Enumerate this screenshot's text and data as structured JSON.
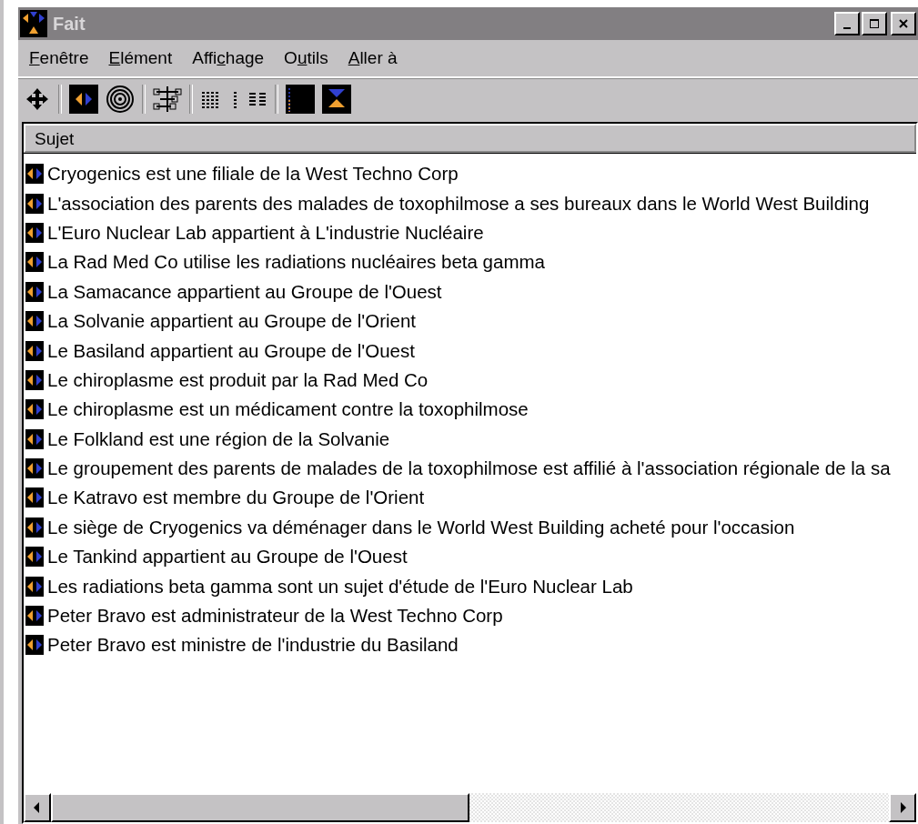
{
  "window": {
    "title": "Fait"
  },
  "menu": [
    {
      "key": "F",
      "after": "enêtre"
    },
    {
      "key": "E",
      "after": "lément"
    },
    {
      "before": "Affi",
      "key": "c",
      "after": "hage"
    },
    {
      "before": "O",
      "key": "u",
      "after": "tils"
    },
    {
      "key": "A",
      "after": "ller à"
    }
  ],
  "toolbar": [
    [
      {
        "kind": "move"
      }
    ],
    [
      {
        "kind": "split"
      },
      {
        "kind": "target"
      }
    ],
    [
      {
        "kind": "tree"
      }
    ],
    [
      {
        "kind": "grid"
      },
      {
        "kind": "dots"
      },
      {
        "kind": "list"
      }
    ],
    [
      {
        "kind": "panel"
      },
      {
        "kind": "arrows"
      }
    ]
  ],
  "table": {
    "columns": [
      "Sujet"
    ],
    "rows": [
      "Cryogenics est une filiale de la West Techno Corp",
      "L'association des parents des malades de toxophilmose a ses bureaux dans le World West Building",
      "L'Euro Nuclear Lab appartient à L'industrie Nucléaire",
      "La Rad Med Co utilise les radiations nucléaires beta gamma",
      "La Samacance appartient au Groupe de l'Ouest",
      "La Solvanie appartient au Groupe de l'Orient",
      "Le Basiland appartient au Groupe de l'Ouest",
      "Le chiroplasme est produit par la Rad Med Co",
      "Le chiroplasme est un médicament contre la toxophilmose",
      "Le Folkland est une région de la Solvanie",
      "Le groupement des parents de malades de la toxophilmose est affilié à l'association régionale de la sa",
      "Le Katravo est membre du Groupe de l'Orient",
      "Le siège de Cryogenics va déménager dans le World West Building acheté pour l'occasion",
      "Le Tankind appartient au Groupe de l'Ouest",
      "Les radiations beta gamma sont un sujet d'étude de l'Euro Nuclear Lab",
      "Peter Bravo est administrateur de la West Techno Corp",
      "Peter Bravo est ministre de l'industrie du Basiland"
    ]
  }
}
